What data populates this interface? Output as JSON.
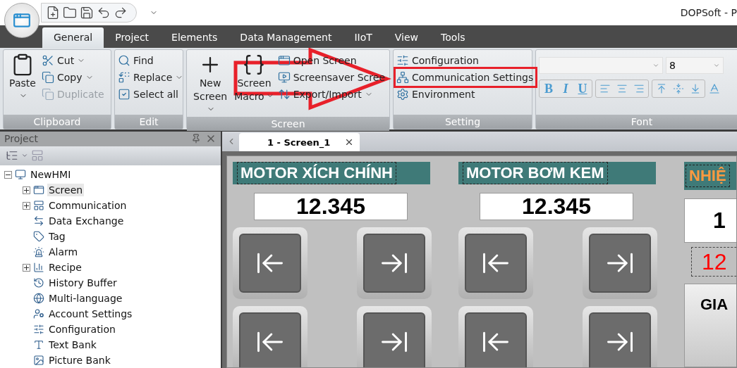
{
  "window": {
    "title": "DOPSoft - P"
  },
  "tabs": [
    {
      "label": "General",
      "selected": true
    },
    {
      "label": "Project",
      "selected": false
    },
    {
      "label": "Elements",
      "selected": false
    },
    {
      "label": "Data Management",
      "selected": false
    },
    {
      "label": "IIoT",
      "selected": false
    },
    {
      "label": "View",
      "selected": false
    },
    {
      "label": "Tools",
      "selected": false
    }
  ],
  "ribbon": {
    "groups": [
      {
        "label": "Clipboard",
        "items": [
          {
            "kind": "large",
            "label": "Paste",
            "dropdown": true,
            "disabled": false,
            "highlighted": false
          },
          {
            "kind": "small",
            "label": "Cut",
            "dropdown": true,
            "disabled": false,
            "highlighted": false
          },
          {
            "kind": "small",
            "label": "Copy",
            "dropdown": true,
            "disabled": false,
            "highlighted": false
          },
          {
            "kind": "small",
            "label": "Duplicate",
            "dropdown": false,
            "disabled": true,
            "highlighted": false
          }
        ]
      },
      {
        "label": "Edit",
        "items": [
          {
            "kind": "small",
            "label": "Find",
            "dropdown": false,
            "disabled": false,
            "highlighted": false
          },
          {
            "kind": "small",
            "label": "Replace",
            "dropdown": true,
            "disabled": false,
            "highlighted": false
          },
          {
            "kind": "small",
            "label": "Select all",
            "dropdown": false,
            "disabled": false,
            "highlighted": false
          }
        ]
      },
      {
        "label": "Screen",
        "items": [
          {
            "kind": "large",
            "label": "New Screen",
            "dropdown": true,
            "disabled": false,
            "highlighted": false
          },
          {
            "kind": "large",
            "label": "Screen Macro",
            "dropdown": true,
            "disabled": false,
            "highlighted": false
          },
          {
            "kind": "small",
            "label": "Open Screen",
            "dropdown": false,
            "disabled": false,
            "highlighted": false
          },
          {
            "kind": "small",
            "label": "Screensaver Scree",
            "dropdown": false,
            "disabled": false,
            "highlighted": false
          },
          {
            "kind": "small",
            "label": "Export/Import",
            "dropdown": true,
            "disabled": false,
            "highlighted": false
          }
        ]
      },
      {
        "label": "Setting",
        "items": [
          {
            "kind": "small",
            "label": "Configuration",
            "dropdown": false,
            "disabled": false,
            "highlighted": false
          },
          {
            "kind": "small",
            "label": "Communication Settings",
            "dropdown": false,
            "disabled": false,
            "highlighted": true
          },
          {
            "kind": "small",
            "label": "Environment",
            "dropdown": false,
            "disabled": false,
            "highlighted": false
          }
        ]
      },
      {
        "label": "Font",
        "font_size": "8",
        "format_buttons": [
          "B",
          "I",
          "U"
        ]
      }
    ]
  },
  "project_panel": {
    "title": "Project",
    "tree": [
      {
        "label": "NewHMI",
        "selected": false,
        "expanded": true,
        "children": [
          {
            "label": "Screen",
            "selected": true,
            "expanded": false
          },
          {
            "label": "Communication",
            "selected": false,
            "expanded": false
          },
          {
            "label": "Data Exchange",
            "selected": false
          },
          {
            "label": "Tag",
            "selected": false
          },
          {
            "label": "Alarm",
            "selected": false
          },
          {
            "label": "Recipe",
            "selected": false,
            "expanded": false
          },
          {
            "label": "History Buffer",
            "selected": false
          },
          {
            "label": "Multi-language",
            "selected": false
          },
          {
            "label": "Account Settings",
            "selected": false
          },
          {
            "label": "Configuration",
            "selected": false
          },
          {
            "label": "Text Bank",
            "selected": false
          },
          {
            "label": "Picture Bank",
            "selected": false
          }
        ]
      }
    ]
  },
  "document_tabs": [
    {
      "label": "1 - Screen_1",
      "selected": true
    }
  ],
  "hmi_screen": {
    "panels": [
      {
        "kind": "motor",
        "title": "MOTOR XÍCH CHÍNH",
        "color": "#ffffff",
        "value": "12.345"
      },
      {
        "kind": "motor",
        "title": "MOTOR BƠM KEM",
        "color": "#ffffff",
        "value": "12.345"
      },
      {
        "kind": "temperature",
        "title": "NHIỆ",
        "color": "#ff9a40",
        "value": "1",
        "readout": "12",
        "button": "GIA"
      }
    ]
  }
}
